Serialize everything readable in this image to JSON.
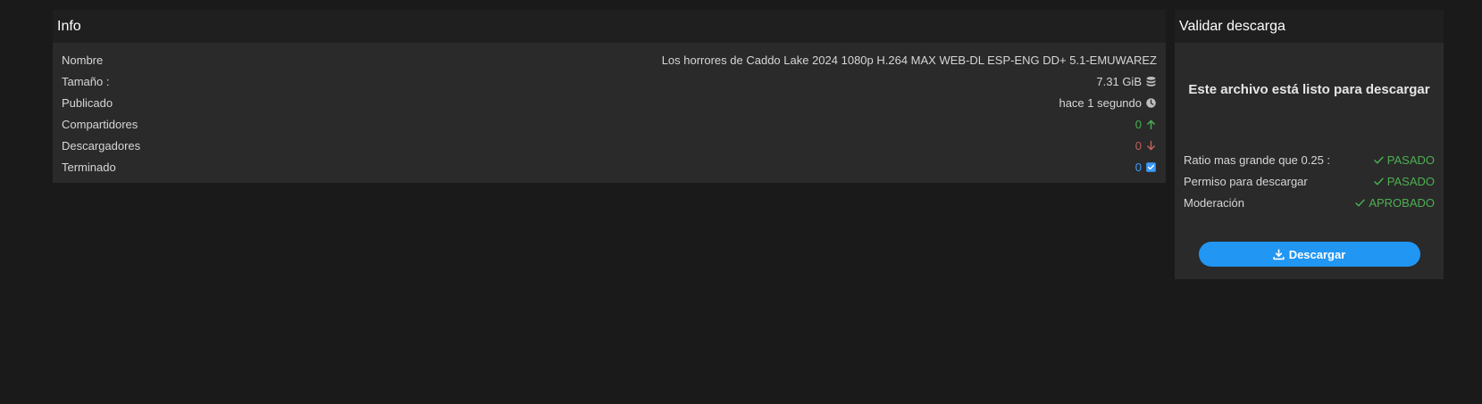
{
  "info": {
    "title": "Info",
    "rows": [
      {
        "label": "Nombre",
        "value": "Los horrores de Caddo Lake 2024 1080p H.264 MAX WEB-DL ESP-ENG DD+ 5.1-EMUWAREZ"
      },
      {
        "label": "Tamaño :",
        "value": "7.31 GiB",
        "icon": "database-icon"
      },
      {
        "label": "Publicado",
        "value": "hace 1 segundo",
        "icon": "clock-icon"
      },
      {
        "label": "Compartidores",
        "value": "0",
        "icon": "arrow-up-icon",
        "color": "#4caf50"
      },
      {
        "label": "Descargadores",
        "value": "0",
        "icon": "arrow-down-icon",
        "color": "#c0625c"
      },
      {
        "label": "Terminado",
        "value": "0",
        "icon": "checkbox-icon",
        "color": "#3d9bff"
      }
    ]
  },
  "validate": {
    "title": "Validar descarga",
    "ready_text": "Este archivo está listo para descargar",
    "checks": [
      {
        "label": "Ratio mas grande que 0.25 :",
        "status": "PASADO"
      },
      {
        "label": "Permiso para descargar",
        "status": "PASADO"
      },
      {
        "label": "Moderación",
        "status": "APROBADO"
      }
    ],
    "button_label": "Descargar",
    "button_icon": "download-icon",
    "accent": "#2196f3",
    "status_color": "#4caf50"
  }
}
